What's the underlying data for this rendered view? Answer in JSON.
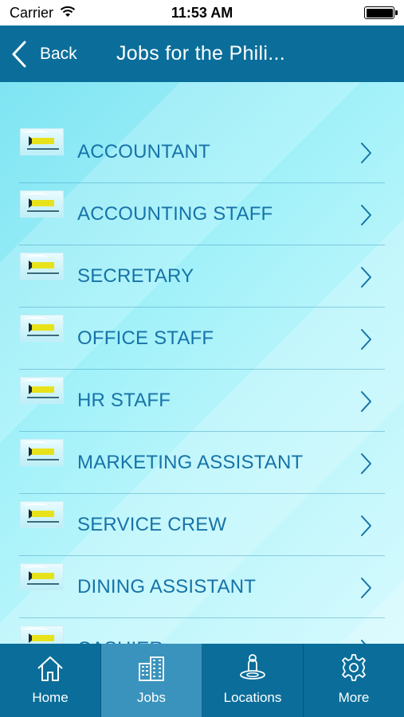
{
  "status_bar": {
    "carrier": "Carrier",
    "time": "11:53 AM",
    "battery_level": 1.0
  },
  "nav_bar": {
    "back_label": "Back",
    "title": "Jobs for the Phili..."
  },
  "jobs": [
    {
      "label": "ACCOUNTANT"
    },
    {
      "label": "ACCOUNTING STAFF"
    },
    {
      "label": "SECRETARY"
    },
    {
      "label": "OFFICE STAFF"
    },
    {
      "label": "HR STAFF"
    },
    {
      "label": "MARKETING ASSISTANT"
    },
    {
      "label": "SERVICE CREW"
    },
    {
      "label": "DINING ASSISTANT"
    },
    {
      "label": "CASHIER"
    }
  ],
  "tab_bar": {
    "tabs": [
      {
        "label": "Home",
        "icon": "home-icon",
        "active": false
      },
      {
        "label": "Jobs",
        "icon": "buildings-icon",
        "active": true
      },
      {
        "label": "Locations",
        "icon": "location-person-icon",
        "active": false
      },
      {
        "label": "More",
        "icon": "gear-icon",
        "active": false
      }
    ]
  },
  "colors": {
    "nav_background": "#0b6e9a",
    "active_tab": "#3a93bd",
    "job_text": "#1773a8"
  }
}
